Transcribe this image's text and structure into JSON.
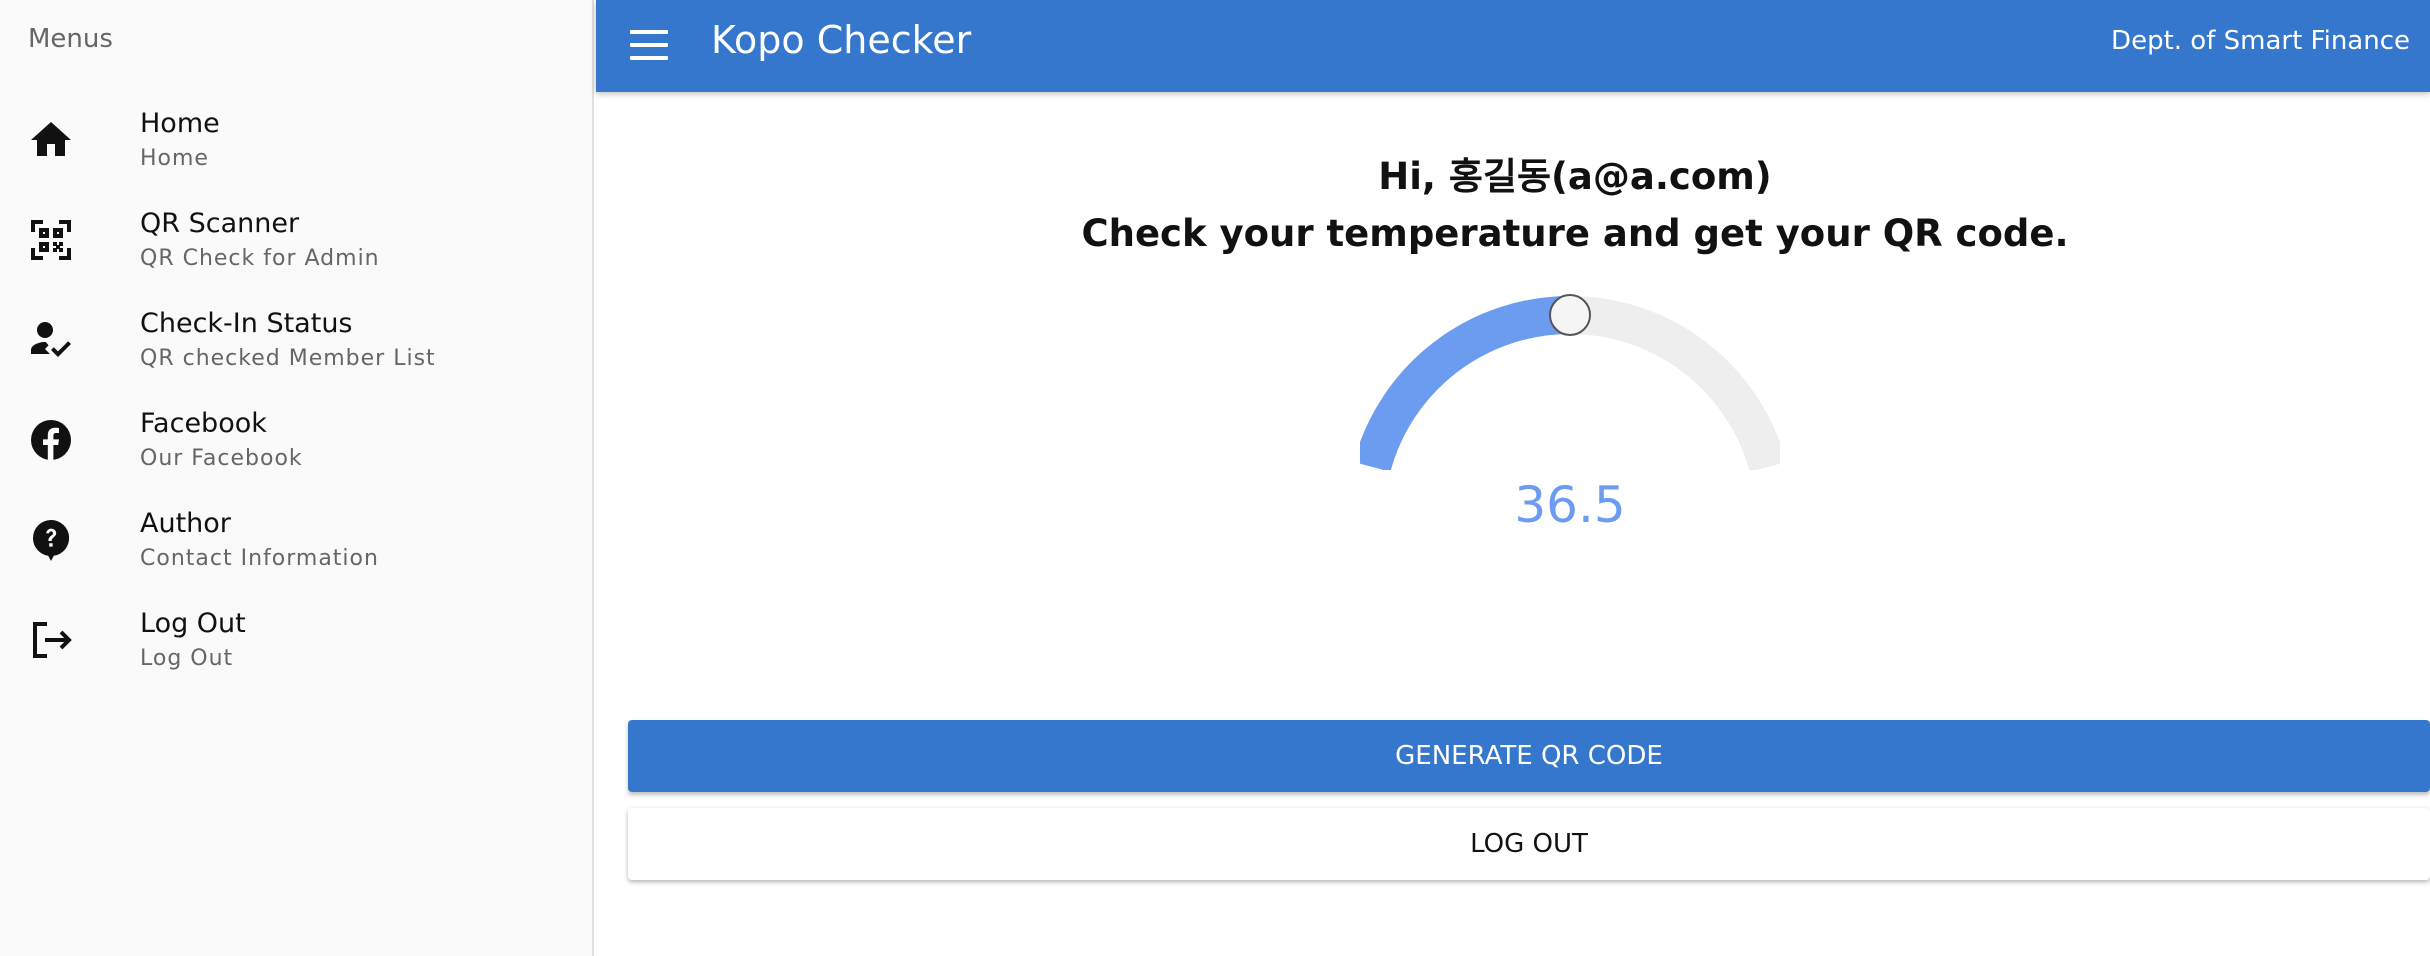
{
  "drawer": {
    "header": "Menus",
    "items": [
      {
        "title": "Home",
        "subtitle": "Home",
        "icon": "home-icon"
      },
      {
        "title": "QR Scanner",
        "subtitle": "QR Check for Admin",
        "icon": "qr-code-scanner-icon"
      },
      {
        "title": "Check-In Status",
        "subtitle": "QR checked Member List",
        "icon": "how-to-reg-icon"
      },
      {
        "title": "Facebook",
        "subtitle": "Our Facebook",
        "icon": "facebook-icon"
      },
      {
        "title": "Author",
        "subtitle": "Contact Information",
        "icon": "help-icon"
      },
      {
        "title": "Log Out",
        "subtitle": "Log Out",
        "icon": "logout-icon"
      }
    ]
  },
  "appbar": {
    "title": "Kopo Checker",
    "department": "Dept. of Smart Finance",
    "menu_icon": "menu-icon"
  },
  "main": {
    "greeting": "Hi, 홍길동(a@a.com)",
    "instruction": "Check your temperature and get your QR code.",
    "temperature": "36.5",
    "gauge_level": 0.5,
    "generate_button": "GENERATE QR CODE",
    "logout_button": "LOG OUT"
  },
  "colors": {
    "primary": "#3577cc",
    "gauge_fill": "#6c9cf0",
    "gauge_track": "#eeeeee"
  }
}
